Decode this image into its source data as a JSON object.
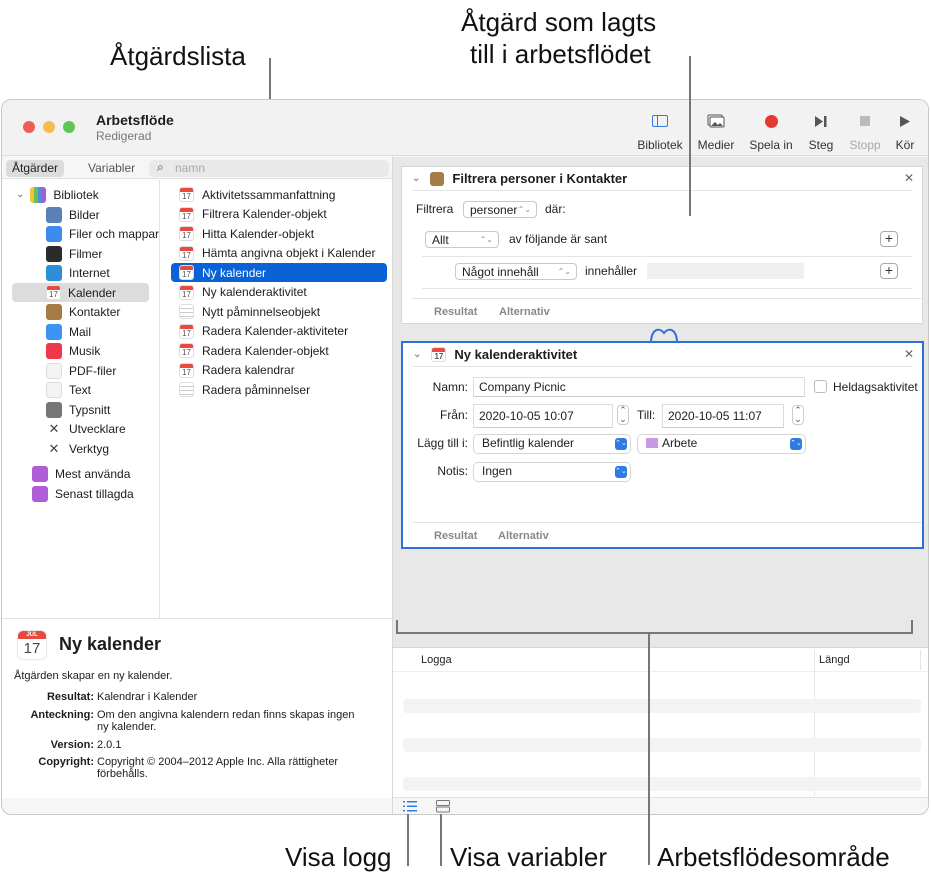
{
  "callouts": {
    "action_list": "Åtgärdslista",
    "action_added_line1": "Åtgärd som lagts",
    "action_added_line2": "till i arbetsflödet",
    "show_log": "Visa logg",
    "show_variables": "Visa variabler",
    "workflow_area": "Arbetsflödesområde"
  },
  "window": {
    "title": "Arbetsflöde",
    "subtitle": "Redigerad"
  },
  "toolbar": {
    "library": "Bibliotek",
    "media": "Medier",
    "record": "Spela in",
    "step": "Steg",
    "stop": "Stopp",
    "run": "Kör",
    "record_color": "#e5392f",
    "accent": "#2f7ae5"
  },
  "sidebar": {
    "tab_actions": "Åtgärder",
    "tab_variables": "Variabler",
    "search_placeholder": "namn",
    "library_root": "Bibliotek",
    "library_items": [
      {
        "label": "Bilder",
        "icon": "photos-icon"
      },
      {
        "label": "Filer och mappar",
        "icon": "finder-icon"
      },
      {
        "label": "Filmer",
        "icon": "quicktime-icon"
      },
      {
        "label": "Internet",
        "icon": "globe-icon"
      },
      {
        "label": "Kalender",
        "icon": "calendar-icon",
        "selected": true
      },
      {
        "label": "Kontakter",
        "icon": "contacts-icon"
      },
      {
        "label": "Mail",
        "icon": "mail-icon"
      },
      {
        "label": "Musik",
        "icon": "music-icon"
      },
      {
        "label": "PDF-filer",
        "icon": "pdf-icon"
      },
      {
        "label": "Text",
        "icon": "text-icon"
      },
      {
        "label": "Typsnitt",
        "icon": "fonts-icon"
      },
      {
        "label": "Utvecklare",
        "icon": "developer-icon"
      },
      {
        "label": "Verktyg",
        "icon": "utilities-icon"
      }
    ],
    "smart_groups": [
      "Mest använda",
      "Senast tillagda"
    ]
  },
  "actions": [
    {
      "label": "Aktivitetssammanfattning",
      "icon": "calendar"
    },
    {
      "label": "Filtrera Kalender-objekt",
      "icon": "calendar"
    },
    {
      "label": "Hitta Kalender-objekt",
      "icon": "calendar"
    },
    {
      "label": "Hämta angivna objekt i Kalender",
      "icon": "calendar"
    },
    {
      "label": "Ny kalender",
      "icon": "calendar",
      "selected": true
    },
    {
      "label": "Ny kalenderaktivitet",
      "icon": "calendar"
    },
    {
      "label": "Nytt påminnelseobjekt",
      "icon": "reminders"
    },
    {
      "label": "Radera Kalender-aktiviteter",
      "icon": "calendar"
    },
    {
      "label": "Radera Kalender-objekt",
      "icon": "calendar"
    },
    {
      "label": "Radera kalendrar",
      "icon": "calendar"
    },
    {
      "label": "Radera påminnelser",
      "icon": "reminders"
    }
  ],
  "description": {
    "icon_month": "JUL",
    "icon_day": "17",
    "title": "Ny kalender",
    "summary": "Åtgärden skapar en ny kalender.",
    "rows": [
      {
        "key": "Resultat:",
        "value": "Kalendrar i Kalender"
      },
      {
        "key": "Anteckning:",
        "value": "Om den angivna kalendern redan finns skapas ingen ny kalender."
      },
      {
        "key": "Version:",
        "value": "2.0.1"
      },
      {
        "key": "Copyright:",
        "value": "Copyright © 2004–2012 Apple Inc. Alla rättigheter förbehålls."
      }
    ]
  },
  "workflow": {
    "card1": {
      "title": "Filtrera personer i Kontakter",
      "filter_label": "Filtrera",
      "filter_value": "personer",
      "where_label": "där:",
      "match_value": "Allt",
      "match_text": "av följande är sant",
      "criteria_field": "Något innehåll",
      "criteria_op": "innehåller",
      "criteria_value": "",
      "tab_results": "Resultat",
      "tab_options": "Alternativ"
    },
    "card2": {
      "title": "Ny kalenderaktivitet",
      "name_label": "Namn:",
      "name_value": "Company Picnic",
      "allday_label": "Heldagsaktivitet",
      "allday_checked": false,
      "from_label": "Från:",
      "from_value": "2020-10-05 10:07",
      "to_label": "Till:",
      "to_value": "2020-10-05 11:07",
      "add_to_label": "Lägg till i:",
      "add_to_value": "Befintlig kalender",
      "calendar_value": "Arbete",
      "calendar_color": "#c99ae0",
      "alert_label": "Notis:",
      "alert_value": "Ingen",
      "tab_results": "Resultat",
      "tab_options": "Alternativ"
    }
  },
  "log": {
    "col_log": "Logga",
    "col_duration": "Längd"
  }
}
